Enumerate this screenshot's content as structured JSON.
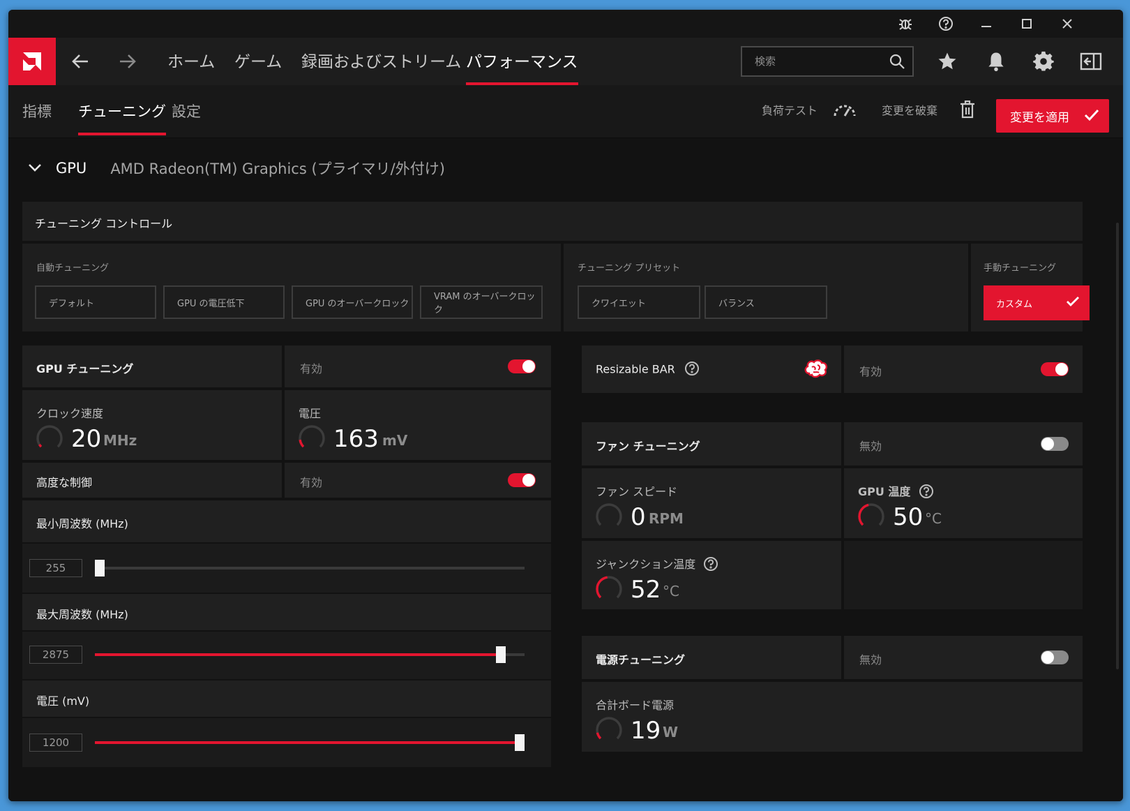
{
  "nav": {
    "items": [
      "ホーム",
      "ゲーム",
      "録画およびストリーム",
      "パフォーマンス"
    ],
    "active": 3,
    "search_placeholder": "検索"
  },
  "subnav": {
    "items": [
      "指標",
      "チューニング",
      "設定"
    ],
    "active": 1,
    "stress_test_label": "負荷テスト",
    "discard_label": "変更を破棄",
    "apply_label": "変更を適用"
  },
  "gpu": {
    "label": "GPU",
    "name": "AMD Radeon(TM) Graphics (プライマリ/外付け)"
  },
  "tuning_control": {
    "title": "チューニング コントロール",
    "auto": {
      "label": "自動チューニング",
      "buttons": [
        "デフォルト",
        "GPU の電圧低下",
        "GPU のオーバークロック",
        "VRAM のオーバークロック"
      ]
    },
    "preset": {
      "label": "チューニング プリセット",
      "buttons": [
        "クワイエット",
        "バランス"
      ]
    },
    "manual": {
      "label": "手動チューニング",
      "button": "カスタム"
    }
  },
  "gpu_tuning": {
    "title": "GPU チューニング",
    "state": "有効",
    "enabled": true,
    "clock": {
      "label": "クロック速度",
      "value": "20",
      "unit": "MHz",
      "level": 0.05
    },
    "voltage": {
      "label": "電圧",
      "value": "163",
      "unit": "mV",
      "level": 0.14
    },
    "advanced": {
      "title": "高度な制御",
      "state": "有効",
      "enabled": true
    },
    "min_freq": {
      "label": "最小周波数 (MHz)",
      "value": "255",
      "position": 0.01
    },
    "max_freq": {
      "label": "最大周波数 (MHz)",
      "value": "2875",
      "position": 0.945
    },
    "voltage_slider": {
      "label": "電圧 (mV)",
      "value": "1200",
      "position": 1.0
    }
  },
  "resizable_bar": {
    "title": "Resizable BAR",
    "state": "有効",
    "enabled": true
  },
  "fan_tuning": {
    "title": "ファン チューニング",
    "state": "無効",
    "enabled": false,
    "fan_speed": {
      "label": "ファン スピード",
      "value": "0",
      "unit": "RPM",
      "level": 0.0
    },
    "gpu_temp": {
      "label": "GPU 温度",
      "value": "50",
      "unit": "°C",
      "level": 0.45
    },
    "junction_temp": {
      "label": "ジャンクション温度",
      "value": "52",
      "unit": "°C",
      "level": 0.47
    }
  },
  "power_tuning": {
    "title": "電源チューニング",
    "state": "無効",
    "enabled": false,
    "board_power": {
      "label": "合計ボード電源",
      "value": "19",
      "unit": "W",
      "level": 0.12
    }
  },
  "colors": {
    "accent": "#e3152f",
    "panel": "#1e1e1e",
    "background": "#121212"
  }
}
